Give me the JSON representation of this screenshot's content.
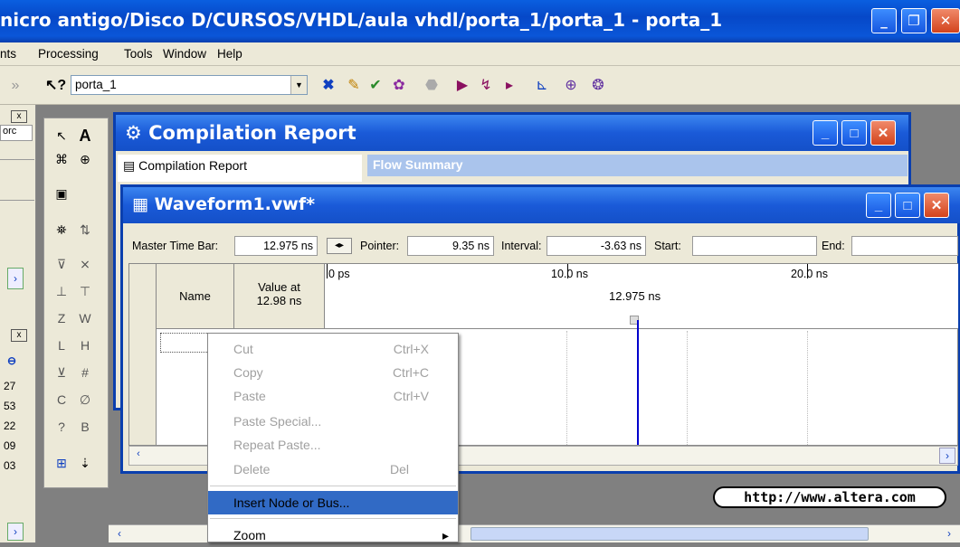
{
  "window": {
    "title": "nicro antigo/Disco D/CURSOS/VHDL/aula vhdl/porta_1/porta_1 - porta_1"
  },
  "menu": [
    "nts",
    "Processing",
    "Tools",
    "Window",
    "Help"
  ],
  "toolbar": {
    "project": "porta_1"
  },
  "left_panel": {
    "tab": "orc",
    "numbers": [
      "27",
      "53",
      "22",
      "09",
      "03"
    ]
  },
  "compilation_report": {
    "title": "Compilation Report",
    "tree_root": "Compilation Report",
    "tab": "Flow Summary"
  },
  "waveform": {
    "title": "Waveform1.vwf*",
    "master_time_bar_label": "Master Time Bar:",
    "master_time_bar_value": "12.975 ns",
    "pointer_label": "Pointer:",
    "pointer_value": "9.35 ns",
    "interval_label": "Interval:",
    "interval_value": "-3.63 ns",
    "start_label": "Start:",
    "start_value": "",
    "end_label": "End:",
    "end_value": "",
    "col_name": "Name",
    "col_value": "Value at\n12.98 ns",
    "ticks": [
      "0 ps",
      "10.0 ns",
      "20.0 ns"
    ],
    "cursor_label": "12.975 ns"
  },
  "context_menu": [
    {
      "label": "Cut",
      "shortcut": "Ctrl+X",
      "enabled": false
    },
    {
      "label": "Copy",
      "shortcut": "Ctrl+C",
      "enabled": false
    },
    {
      "label": "Paste",
      "shortcut": "Ctrl+V",
      "enabled": false
    },
    {
      "label": "Paste Special...",
      "shortcut": "",
      "enabled": false
    },
    {
      "label": "Repeat Paste...",
      "shortcut": "",
      "enabled": false
    },
    {
      "label": "Delete",
      "shortcut": "Del",
      "enabled": false
    },
    {
      "label": "Insert Node or Bus...",
      "shortcut": "",
      "enabled": true,
      "highlighted": true
    },
    {
      "label": "Zoom",
      "shortcut": "",
      "enabled": true,
      "submenu": true
    }
  ],
  "footer": {
    "url": "http://www.altera.com"
  },
  "colors": {
    "title_blue": "#0a56d8",
    "selection": "#316ac5",
    "cursor_line": "#0000cc"
  }
}
